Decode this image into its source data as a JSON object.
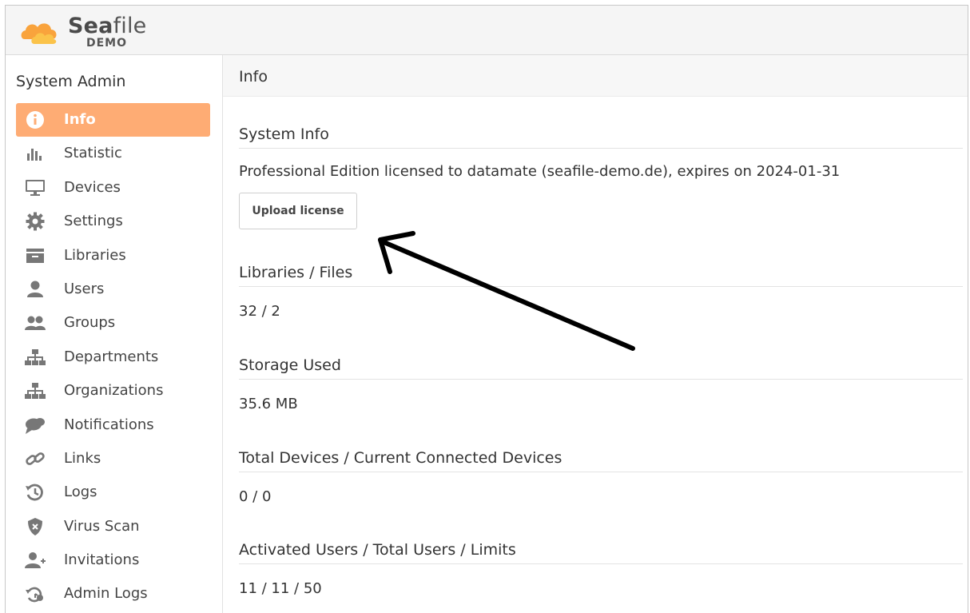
{
  "brand": {
    "name_bold": "Sea",
    "name_rest": "file",
    "subtitle": "DEMO",
    "accent": "#feac74"
  },
  "sidebar": {
    "title": "System Admin",
    "items": [
      {
        "label": "Info",
        "icon": "info-icon",
        "active": true
      },
      {
        "label": "Statistic",
        "icon": "bar-chart-icon"
      },
      {
        "label": "Devices",
        "icon": "monitor-icon"
      },
      {
        "label": "Settings",
        "icon": "gear-icon"
      },
      {
        "label": "Libraries",
        "icon": "archive-icon"
      },
      {
        "label": "Users",
        "icon": "user-icon"
      },
      {
        "label": "Groups",
        "icon": "users-icon"
      },
      {
        "label": "Departments",
        "icon": "sitemap-icon"
      },
      {
        "label": "Organizations",
        "icon": "sitemap-icon"
      },
      {
        "label": "Notifications",
        "icon": "chat-bubbles-icon"
      },
      {
        "label": "Links",
        "icon": "link-icon"
      },
      {
        "label": "Logs",
        "icon": "history-icon"
      },
      {
        "label": "Virus Scan",
        "icon": "shield-icon"
      },
      {
        "label": "Invitations",
        "icon": "user-plus-icon"
      },
      {
        "label": "Admin Logs",
        "icon": "admin-history-icon"
      }
    ]
  },
  "main": {
    "heading": "Info",
    "system_info": {
      "title": "System Info",
      "license_text": "Professional Edition licensed to datamate (seafile-demo.de), expires on 2024-01-31",
      "upload_button": "Upload license"
    },
    "sections": [
      {
        "title": "Libraries / Files",
        "value": "32 / 2"
      },
      {
        "title": "Storage Used",
        "value": "35.6 MB"
      },
      {
        "title": "Total Devices / Current Connected Devices",
        "value": "0 / 0"
      },
      {
        "title": "Activated Users / Total Users / Limits",
        "value": "11 / 11 / 50"
      }
    ]
  },
  "annotation": {
    "icon": "arrow-annotation-icon",
    "color": "#000000"
  }
}
